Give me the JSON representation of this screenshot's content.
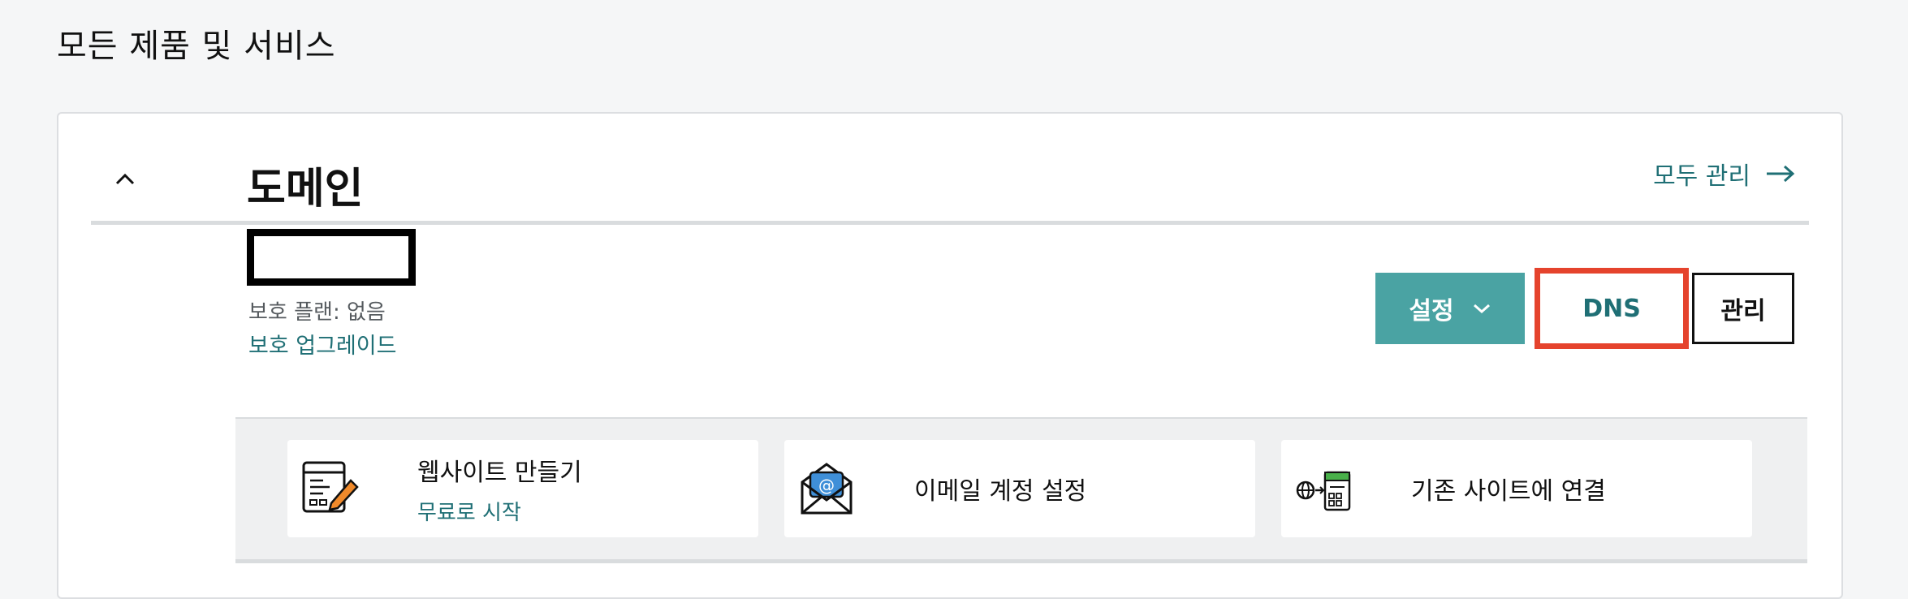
{
  "page": {
    "title": "모든 제품 및 서비스"
  },
  "domains": {
    "section_title": "도메인",
    "manage_all_label": "모두 관리",
    "protection_plan": "보호 플랜: 없음",
    "upgrade_link": "보호 업그레이드",
    "buttons": {
      "settings_label": "설정",
      "dns_label": "DNS",
      "manage_label": "관리"
    },
    "quick_actions": [
      {
        "title": "웹사이트 만들기",
        "subtitle": "무료로 시작",
        "icon": "website-builder-icon"
      },
      {
        "title": "이메일 계정 설정",
        "subtitle": "",
        "icon": "email-icon"
      },
      {
        "title": "기존 사이트에 연결",
        "subtitle": "",
        "icon": "connect-site-icon"
      }
    ]
  },
  "colors": {
    "accent": "#4aa3a3",
    "link": "#1f6f75",
    "highlight_border": "#e5432d",
    "background": "#f5f6f7"
  }
}
